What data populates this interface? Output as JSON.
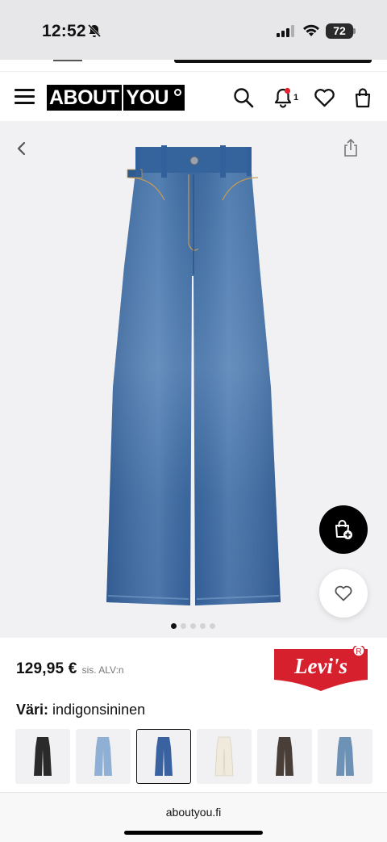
{
  "status_bar": {
    "time": "12:52",
    "battery": "72"
  },
  "header": {
    "logo_left": "ABOUT",
    "logo_right": "YOU",
    "notification_count": "1"
  },
  "gallery": {
    "image_count": 5,
    "active_index": 0
  },
  "product": {
    "price": "129,95 €",
    "vat_note": "sis. ALV:n",
    "brand": "Levi's",
    "color_label": "Väri:",
    "color_value": "indigonsininen",
    "swatches": [
      {
        "name": "black",
        "color": "#2a2a2a"
      },
      {
        "name": "light-blue",
        "color": "#8fb0d4"
      },
      {
        "name": "indigo",
        "color": "#3a62a0",
        "selected": true
      },
      {
        "name": "cream",
        "color": "#efeadc"
      },
      {
        "name": "dark-brown",
        "color": "#4a3e38"
      },
      {
        "name": "mid-blue",
        "color": "#6e92b6"
      }
    ]
  },
  "browser": {
    "url": "aboutyou.fi"
  },
  "colors": {
    "brand_red": "#d6202e",
    "denim": "#4172a8"
  }
}
